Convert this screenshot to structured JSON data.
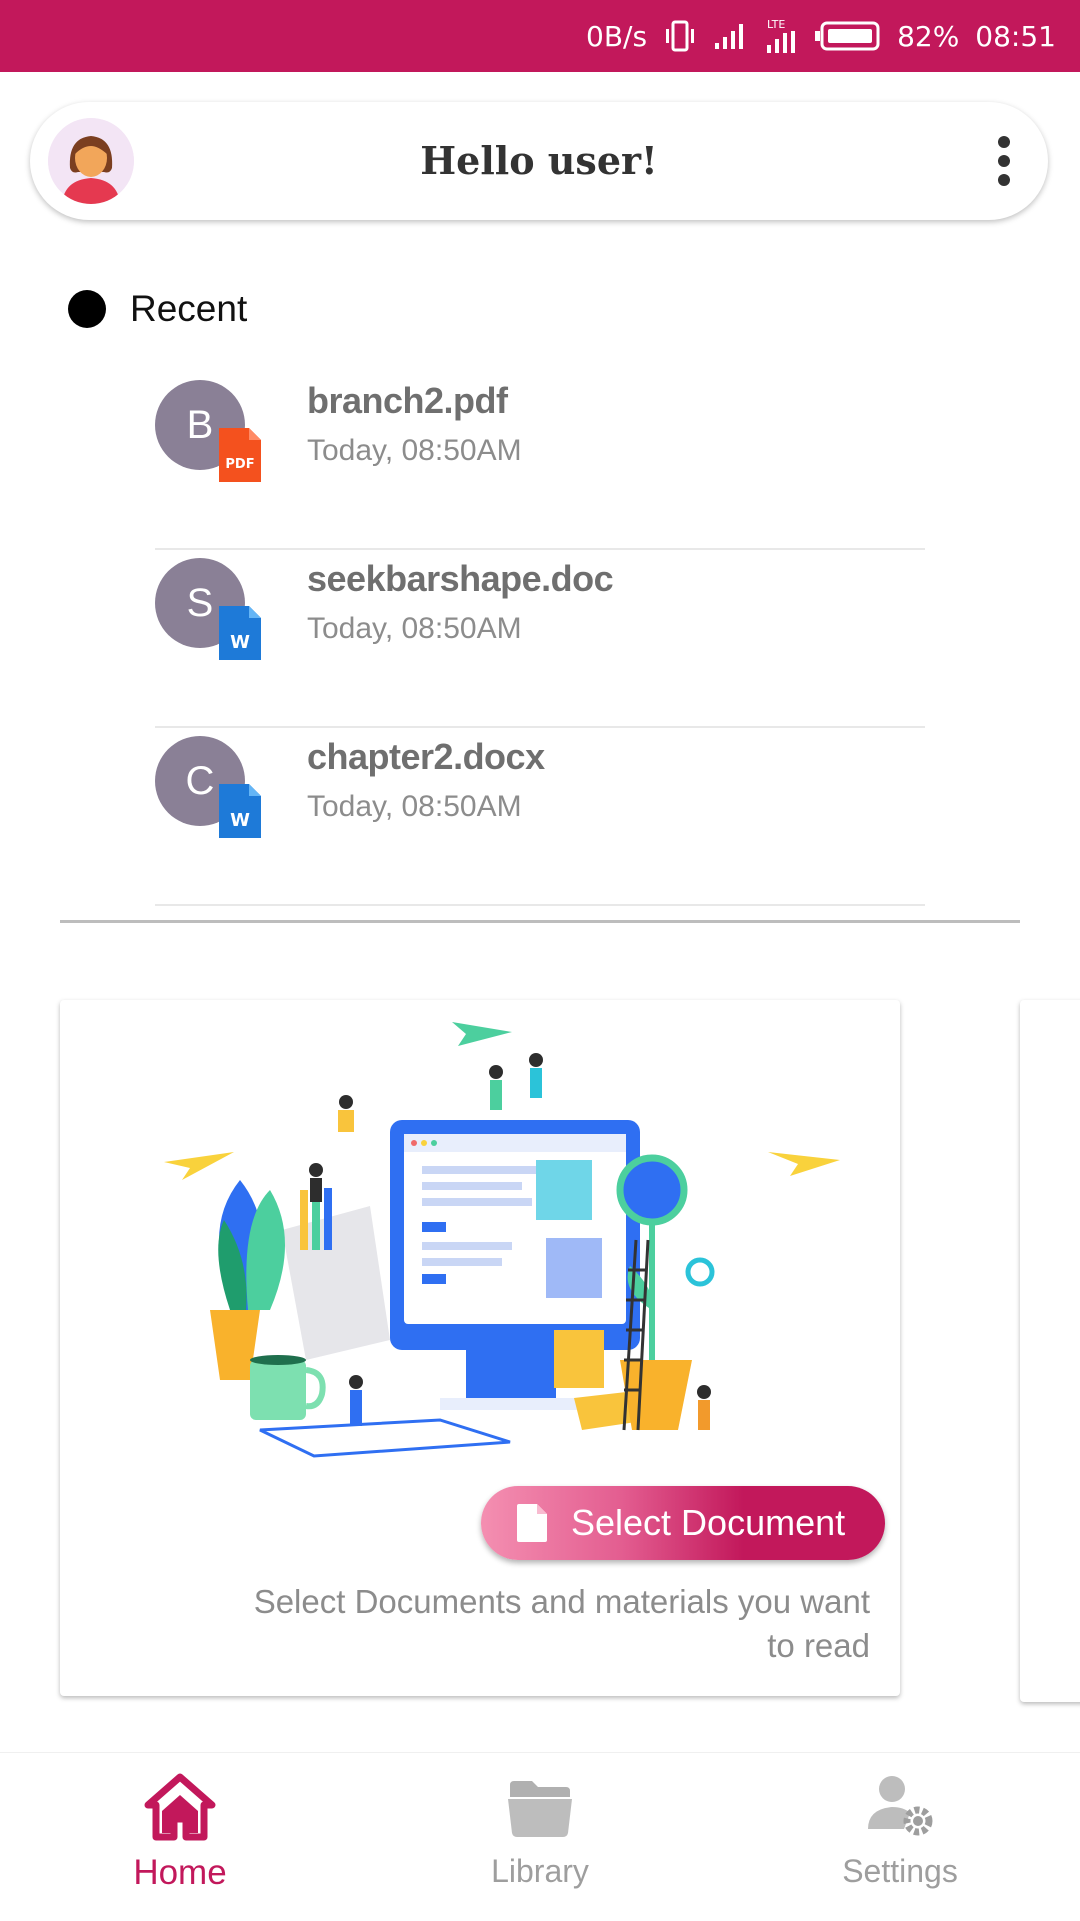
{
  "status_bar": {
    "speed": "0B/s",
    "network": "LTE",
    "battery": "82%",
    "time": "08:51",
    "icons": [
      "vibrate-icon",
      "signal-icon",
      "lte-signal-icon",
      "battery-icon"
    ]
  },
  "header": {
    "title": "Hello user!",
    "avatar_icon": "user-avatar-icon",
    "menu_icon": "more-vert-icon"
  },
  "recent": {
    "label": "Recent",
    "items": [
      {
        "initial": "B",
        "name": "branch2.pdf",
        "time": "Today, 08:50AM",
        "badge": "PDF",
        "badge_color": "#f4511e"
      },
      {
        "initial": "S",
        "name": "seekbarshape.doc",
        "time": "Today, 08:50AM",
        "badge": "W",
        "badge_color": "#1e7ad8"
      },
      {
        "initial": "C",
        "name": "chapter2.docx",
        "time": "Today, 08:50AM",
        "badge": "W",
        "badge_color": "#1e7ad8"
      }
    ]
  },
  "card": {
    "button_label": "Select Document",
    "description": "Select Documents and materials you want to read",
    "illustration_icon": "workspace-illustration"
  },
  "bottom_nav": {
    "items": [
      {
        "label": "Home",
        "icon": "home-icon",
        "active": true
      },
      {
        "label": "Library",
        "icon": "folder-icon",
        "active": false
      },
      {
        "label": "Settings",
        "icon": "user-settings-icon",
        "active": false
      }
    ]
  },
  "colors": {
    "accent": "#c2185b",
    "avatar_bg": "#8a8096",
    "text_secondary": "#8c8c8c"
  }
}
